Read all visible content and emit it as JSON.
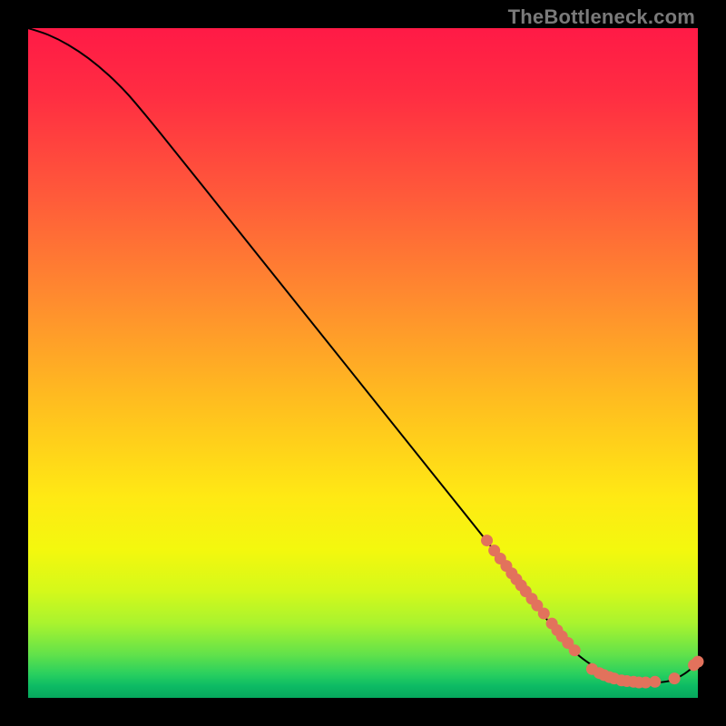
{
  "watermark": {
    "text": "TheBottleneck.com"
  },
  "colors": {
    "curve": "#000000",
    "dot_fill": "#e2725c",
    "dot_stroke": "#9a4a3c"
  },
  "chart_data": {
    "type": "line",
    "title": "",
    "xlabel": "",
    "ylabel": "",
    "xlim": [
      0,
      100
    ],
    "ylim": [
      0,
      100
    ],
    "grid": false,
    "legend": false,
    "series": [
      {
        "name": "curve",
        "x": [
          0,
          3,
          6,
          9,
          12,
          15,
          20,
          30,
          40,
          50,
          60,
          70,
          75,
          78,
          80,
          82,
          84,
          86,
          88,
          90,
          92,
          94,
          96,
          98,
          100
        ],
        "y": [
          100,
          99,
          97.5,
          95.5,
          93,
          90,
          84,
          71.5,
          59,
          46.5,
          34,
          21.5,
          15,
          11,
          8.5,
          6.5,
          5,
          3.8,
          3,
          2.5,
          2.3,
          2.3,
          2.6,
          3.6,
          5.2
        ]
      }
    ],
    "dot_clusters": [
      {
        "name": "upper-cluster",
        "points": [
          [
            68.5,
            23.5
          ],
          [
            69.6,
            22.0
          ],
          [
            70.5,
            20.8
          ],
          [
            71.4,
            19.7
          ],
          [
            72.2,
            18.6
          ],
          [
            72.9,
            17.7
          ],
          [
            73.6,
            16.8
          ],
          [
            74.3,
            15.9
          ],
          [
            75.2,
            14.8
          ],
          [
            76.0,
            13.8
          ],
          [
            77.0,
            12.6
          ],
          [
            78.2,
            11.1
          ],
          [
            79.0,
            10.1
          ],
          [
            79.7,
            9.2
          ],
          [
            80.6,
            8.2
          ],
          [
            81.6,
            7.1
          ]
        ]
      },
      {
        "name": "bottom-cluster",
        "points": [
          [
            84.2,
            4.3
          ],
          [
            85.3,
            3.7
          ],
          [
            86.0,
            3.4
          ],
          [
            86.8,
            3.1
          ],
          [
            87.5,
            2.9
          ],
          [
            88.6,
            2.6
          ],
          [
            89.4,
            2.5
          ],
          [
            90.4,
            2.4
          ],
          [
            91.2,
            2.3
          ],
          [
            92.2,
            2.3
          ],
          [
            93.6,
            2.4
          ],
          [
            96.5,
            2.9
          ]
        ]
      },
      {
        "name": "tail-pair",
        "points": [
          [
            99.4,
            4.9
          ],
          [
            100.0,
            5.4
          ]
        ]
      }
    ]
  }
}
